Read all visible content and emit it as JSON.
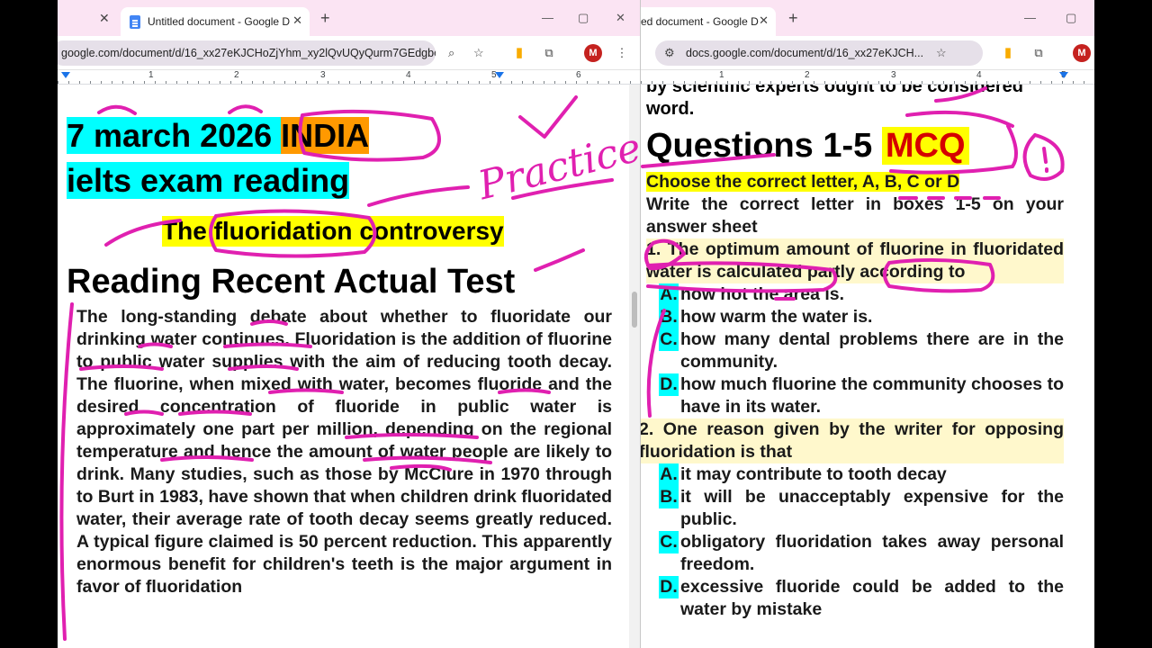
{
  "left_window": {
    "tabs": [
      {
        "label": ""
      },
      {
        "label": "Untitled document - Google D"
      }
    ],
    "new_tab": "+",
    "window_controls": {
      "minimize": "—",
      "maximize": "▢",
      "close": "✕"
    },
    "url": "google.com/document/d/16_xx27eKJCHoZjYhm_xy2lQvUQyQurm7GEdgbc...",
    "avatar": "M",
    "ruler_numbers": [
      "1",
      "2",
      "3",
      "4",
      "5",
      "6"
    ]
  },
  "right_window": {
    "tab": {
      "label": "ed document - Google D"
    },
    "new_tab": "+",
    "window_controls": {
      "minimize": "—",
      "maximize": "▢"
    },
    "url": "docs.google.com/document/d/16_xx27eKJCH...",
    "avatar": "M",
    "ruler_numbers": [
      "1",
      "2",
      "3",
      "4",
      "5"
    ]
  },
  "document": {
    "date": "7 march 2026 ",
    "country": " INDIA",
    "subtitle": "ielts exam reading",
    "title_pre": "The ",
    "title_word": "fluoridation",
    "title_post": " controversy",
    "heading": "Reading Recent Actual Test",
    "passage": "The long-standing debate about whether to fluoridate our drinking water continues. Fluoridation is the addition of fluorine to public water supplies with the aim of reducing tooth decay. The fluorine, when mixed with water, becomes fluoride and the desired concentration of fluoride in public water is approximately one part per million, depending on the regional temperature and hence the amount of water people are likely to drink. Many studies, such as those by McClure in 1970 through to Burt in 1983, have shown that when children drink fluoridated water, their average rate of tooth decay seems greatly reduced. A typical figure claimed is 50 percent reduction. This apparently enormous benefit for children's teeth is the major argument in favor of fluoridation"
  },
  "annotations": {
    "practice": "Practice"
  },
  "questions": {
    "prev_line_1": "by scientific experts ought to be considered",
    "prev_line_2": "word.",
    "heading": "Questions 1-5 ",
    "heading_tag": "MCQ",
    "instruction": "Choose the correct letter, A, B, C or D",
    "write_line": "Write the correct letter in boxes 1-5 on your answer sheet",
    "q1": "1. The optimum amount of fluorine in fluoridated water is calculated partly according to",
    "q1_options": [
      {
        "letter": "A.",
        "text": "how hot the area is."
      },
      {
        "letter": "B.",
        "text": "how warm the water is."
      },
      {
        "letter": "C.",
        "text": "how many dental problems there are in the community."
      },
      {
        "letter": "D.",
        "text": "how much fluorine the community chooses to have in its water."
      }
    ],
    "q2": "2. One reason given by the writer for opposing fluoridation is that",
    "q2_options": [
      {
        "letter": "A.",
        "text": "it may contribute to tooth decay"
      },
      {
        "letter": "B.",
        "text": "it will be unacceptably expensive for the public."
      },
      {
        "letter": "C.",
        "text": "obligatory fluoridation takes away personal freedom."
      },
      {
        "letter": "D.",
        "text": "excessive fluoride could be added to the water by mistake"
      }
    ]
  },
  "colors": {
    "ink": "#e020b0",
    "highlight_cyan": "#00ffff",
    "highlight_yellow": "#ffff00",
    "highlight_orange": "#ff9900",
    "mcq_red": "#d50000"
  }
}
